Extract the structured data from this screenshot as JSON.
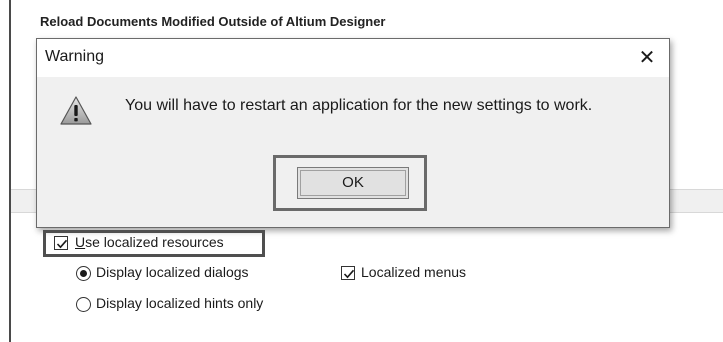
{
  "background_section": {
    "header": "Reload Documents Modified Outside of Altium Designer"
  },
  "dialog": {
    "title": "Warning",
    "close_glyph": "✕",
    "icon": "warning-icon",
    "message": "You will have to restart an application for the new settings to work.",
    "ok_label": "OK"
  },
  "options": {
    "use_localized_resources": {
      "label": "Use localized resources",
      "checked": true
    },
    "display_localized_dialogs": {
      "label": "Display localized dialogs",
      "selected": true
    },
    "display_localized_hints_only": {
      "label": "Display localized hints only",
      "selected": false
    },
    "localized_menus": {
      "label": "Localized menus",
      "checked": true
    }
  },
  "colors": {
    "dialog_background": "#f0f0f0",
    "highlight_border": "#4f4f4f"
  }
}
